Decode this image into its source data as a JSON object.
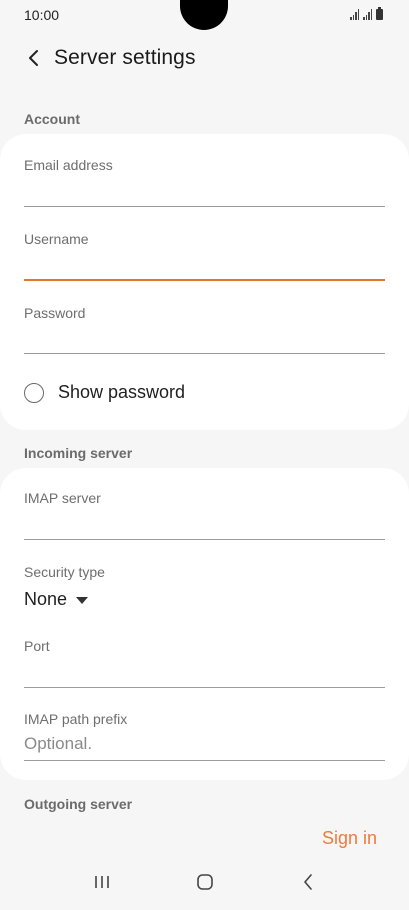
{
  "status_bar": {
    "time": "10:00"
  },
  "app_bar": {
    "title": "Server settings"
  },
  "account": {
    "section_label": "Account",
    "email_label": "Email address",
    "email_value": "",
    "username_label": "Username",
    "username_value": "",
    "password_label": "Password",
    "password_value": "",
    "show_password_label": "Show password"
  },
  "incoming": {
    "section_label": "Incoming server",
    "imap_server_label": "IMAP server",
    "imap_server_value": "",
    "security_type_label": "Security type",
    "security_type_value": "None",
    "port_label": "Port",
    "port_value": "",
    "imap_prefix_label": "IMAP path prefix",
    "imap_prefix_placeholder": "Optional."
  },
  "outgoing": {
    "section_label": "Outgoing server"
  },
  "actions": {
    "sign_in_label": "Sign in"
  },
  "colors": {
    "accent": "#ef7b3a",
    "active_underline": "#e3772c",
    "background": "#f6f6f6",
    "card": "#ffffff"
  },
  "icons": {
    "back": "chevron-left-icon",
    "recents": "recents-icon",
    "home": "home-icon",
    "nav_back": "nav-back-icon"
  }
}
